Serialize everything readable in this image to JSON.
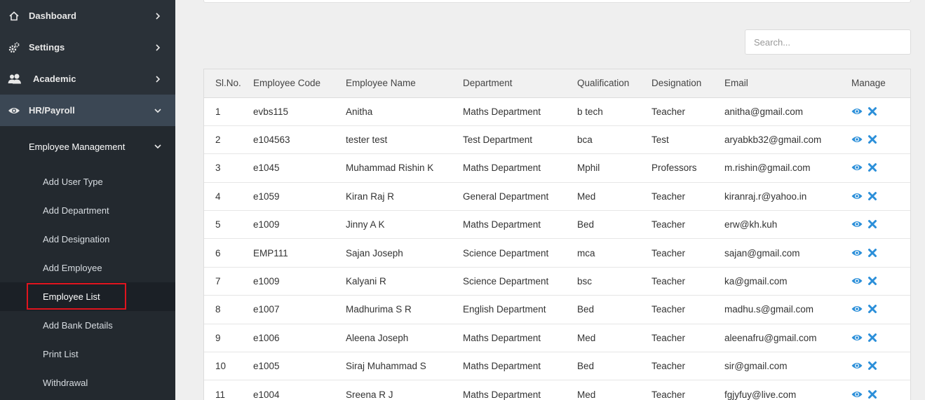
{
  "sidebar": {
    "nav": [
      {
        "label": "Dashboard",
        "icon": "home-icon"
      },
      {
        "label": "Settings",
        "icon": "gears-icon"
      },
      {
        "label": "Academic",
        "icon": "users-icon"
      },
      {
        "label": "HR/Payroll",
        "icon": "eye-icon"
      }
    ],
    "submenu_title": "Employee Management",
    "sub_items": [
      {
        "label": "Add User Type"
      },
      {
        "label": "Add Department"
      },
      {
        "label": "Add Designation"
      },
      {
        "label": "Add Employee"
      },
      {
        "label": "Employee List"
      },
      {
        "label": "Add Bank Details"
      },
      {
        "label": "Print List"
      },
      {
        "label": "Withdrawal"
      }
    ]
  },
  "search": {
    "placeholder": "Search..."
  },
  "table": {
    "headers": [
      "Sl.No.",
      "Employee Code",
      "Employee Name",
      "Department",
      "Qualification",
      "Designation",
      "Email",
      "Manage"
    ],
    "rows": [
      [
        "1",
        "evbs115",
        "Anitha",
        "Maths Department",
        "b tech",
        "Teacher",
        "anitha@gmail.com"
      ],
      [
        "2",
        "e104563",
        "tester test",
        "Test Department",
        "bca",
        "Test",
        "aryabkb32@gmail.com"
      ],
      [
        "3",
        "e1045",
        "Muhammad Rishin K",
        "Maths Department",
        "Mphil",
        "Professors",
        "m.rishin@gmail.com"
      ],
      [
        "4",
        "e1059",
        "Kiran Raj R",
        "General Department",
        "Med",
        "Teacher",
        "kiranraj.r@yahoo.in"
      ],
      [
        "5",
        "e1009",
        "Jinny A K",
        "Maths Department",
        "Bed",
        "Teacher",
        "erw@kh.kuh"
      ],
      [
        "6",
        "EMP111",
        "Sajan Joseph",
        "Science Department",
        "mca",
        "Teacher",
        "sajan@gmail.com"
      ],
      [
        "7",
        "e1009",
        "Kalyani R",
        "Science Department",
        "bsc",
        "Teacher",
        "ka@gmail.com"
      ],
      [
        "8",
        "e1007",
        "Madhurima S R",
        "English Department",
        "Bed",
        "Teacher",
        "madhu.s@gmail.com"
      ],
      [
        "9",
        "e1006",
        "Aleena Joseph",
        "Maths Department",
        "Med",
        "Teacher",
        "aleenafru@gmail.com"
      ],
      [
        "10",
        "e1005",
        "Siraj Muhammad S",
        "Maths Department",
        "Bed",
        "Teacher",
        "sir@gmail.com"
      ],
      [
        "11",
        "e1004",
        "Sreena R J",
        "Maths Department",
        "Med",
        "Teacher",
        "fgjyfuy@live.com"
      ]
    ],
    "manage_icons": [
      "eye-icon",
      "close-icon"
    ]
  },
  "colors": {
    "sidebar_bg": "#2a3138",
    "sidebar_active": "#3b4754",
    "action_blue": "#2b8fd9",
    "highlight_red": "#e0141e"
  }
}
